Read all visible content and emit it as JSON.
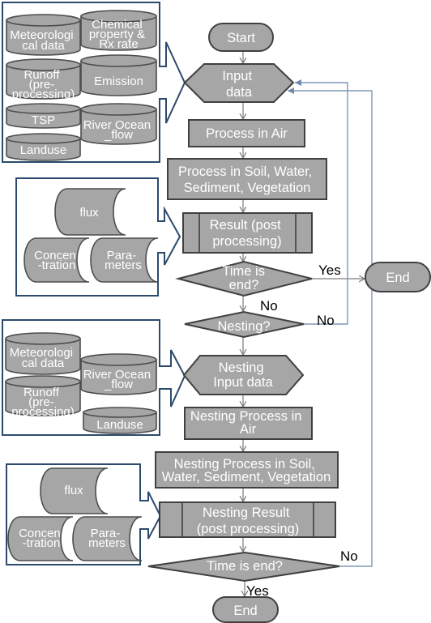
{
  "flow": {
    "start": "Start",
    "input_data": [
      "Input",
      "data"
    ],
    "process_air": "Process in Air",
    "process_soil": [
      "Process in Soil, Water,",
      "Sediment, Vegetation"
    ],
    "result": [
      "Result (post",
      "processing)"
    ],
    "time_is_end": [
      "Time is",
      "end?"
    ],
    "end_main": "End",
    "nesting_decision": "Nesting?",
    "nesting_input": [
      "Nesting",
      "Input data"
    ],
    "nesting_process_air": [
      "Nesting Process in",
      "Air"
    ],
    "nesting_process_soil": [
      "Nesting Process in Soil,",
      "Water, Sediment, Vegetation"
    ],
    "nesting_result": [
      "Nesting Result",
      "(post processing)"
    ],
    "nesting_time_is_end": "Time is end?",
    "end_nesting": "End"
  },
  "branch_labels": {
    "time_end_yes": "Yes",
    "time_end_no": "No",
    "nesting_no": "No",
    "nesting_time_end_no": "No",
    "nesting_time_end_yes": "Yes"
  },
  "input_group": {
    "meteorological_data": [
      "Meteorologi",
      "cal data"
    ],
    "chemical_property": [
      "Chemical",
      "property &",
      "Rx rate"
    ],
    "runoff": [
      "Runoff",
      "(pre-",
      "processing)"
    ],
    "emission": "Emission",
    "tsp": "TSP",
    "river_ocean_flow": [
      "River Ocean",
      "_flow"
    ],
    "landuse": "Landuse"
  },
  "output_group": {
    "flux": "flux",
    "concentration": [
      "Concen",
      "-tration"
    ],
    "parameters": [
      "Para-",
      "meters"
    ]
  },
  "nesting_input_group": {
    "meteorological_data": [
      "Meteorologi",
      "cal data"
    ],
    "river_ocean_flow": [
      "River Ocean",
      "_flow"
    ],
    "runoff": [
      "Runoff",
      "(pre-",
      "processing)"
    ],
    "landuse": "Landuse"
  },
  "nesting_output_group": {
    "flux": "flux",
    "concentration": [
      "Concen",
      "-tration"
    ],
    "parameters": [
      "Para-",
      "meters"
    ]
  },
  "colors": {
    "shape_fill": "#a6a6a6",
    "shape_stroke": "#404040",
    "shape_text": "#ffffff",
    "group_border": "#2c4a6e",
    "feedback_line": "#7f97b5",
    "flow_arrow": "#7a7a7a",
    "label_text": "#000000"
  }
}
